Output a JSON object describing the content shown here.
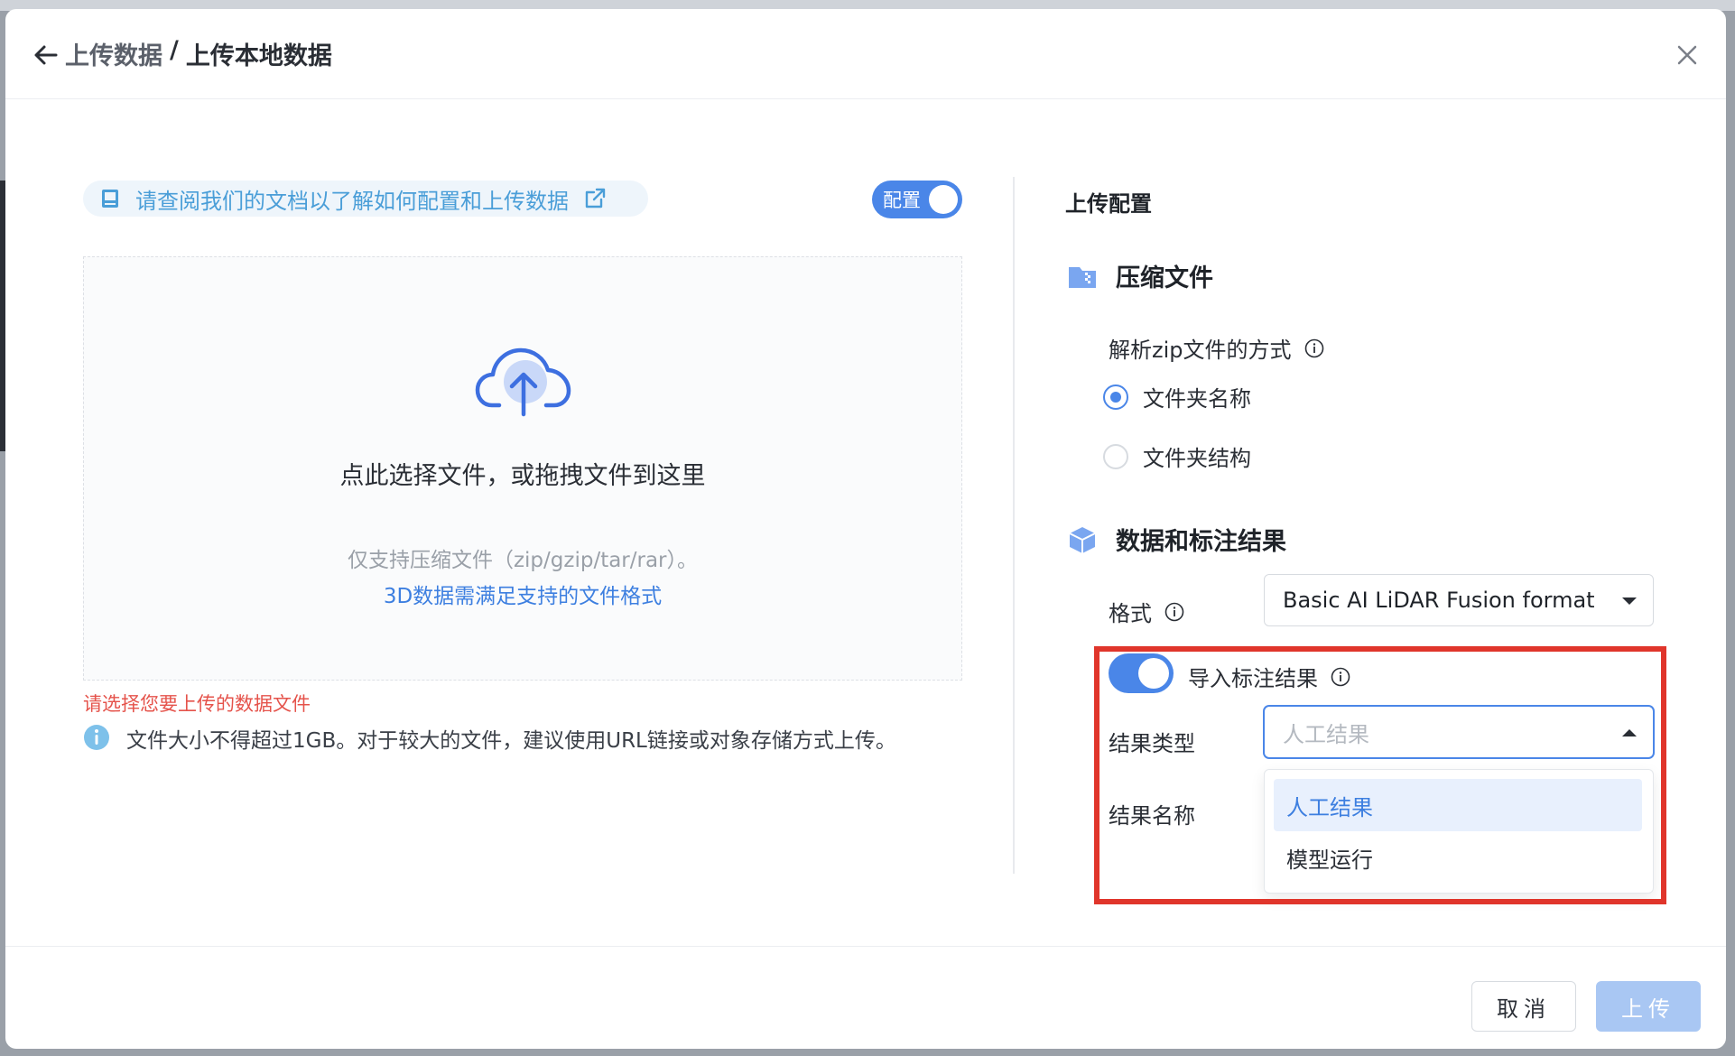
{
  "header": {
    "breadcrumb_parent": "上传数据",
    "separator": "/",
    "title": "上传本地数据"
  },
  "left": {
    "doc_tip": "请查阅我们的文档以了解如何配置和上传数据",
    "config_switch_label": "配置",
    "config_switch_on": true,
    "dropzone": {
      "main": "点此选择文件，或拖拽文件到这里",
      "sub": "仅支持压缩文件（zip/gzip/tar/rar）。",
      "link": "3D数据需满足支持的文件格式"
    },
    "error_text": "请选择您要上传的数据文件",
    "info_text": "文件大小不得超过1GB。对于较大的文件，建议使用URL链接或对象存储方式上传。"
  },
  "right": {
    "section_title": "上传配置",
    "compress": {
      "title": "压缩文件",
      "parse_label": "解析zip文件的方式",
      "options": [
        {
          "label": "文件夹名称",
          "checked": true
        },
        {
          "label": "文件夹结构",
          "checked": false
        }
      ]
    },
    "data_result": {
      "title": "数据和标注结果",
      "format_label": "格式",
      "format_value": "Basic AI LiDAR Fusion format",
      "import_label": "导入标注结果",
      "import_on": true,
      "result_type_label": "结果类型",
      "result_type_placeholder": "人工结果",
      "result_name_label": "结果名称",
      "dropdown_options": [
        {
          "label": "人工结果",
          "active": true
        },
        {
          "label": "模型运行",
          "active": false
        }
      ]
    }
  },
  "footer": {
    "cancel_label": "取消",
    "upload_label": "上传"
  },
  "colors": {
    "accent": "#4a86e8",
    "error": "#e5534b",
    "highlight_box": "#e0352b"
  }
}
